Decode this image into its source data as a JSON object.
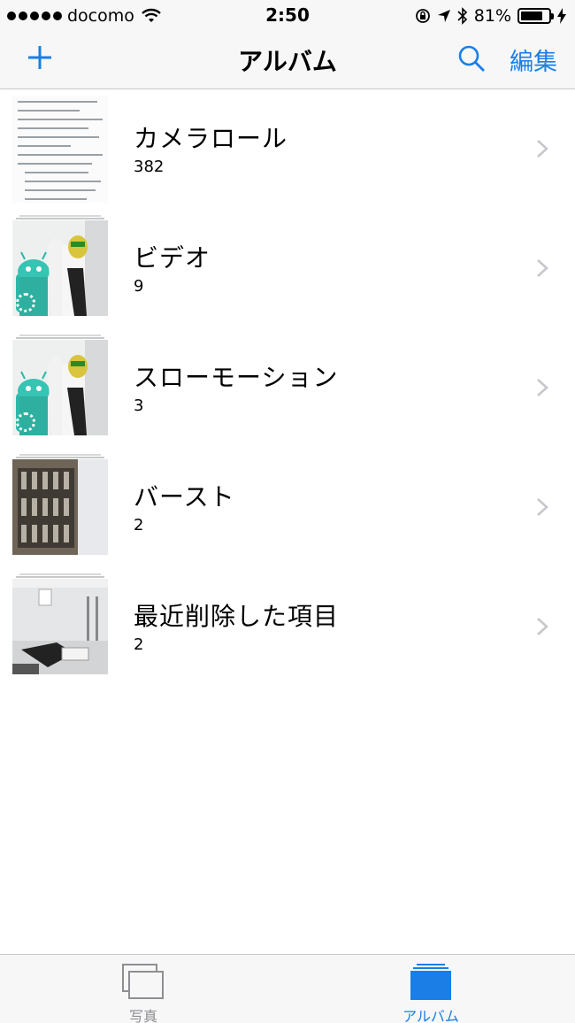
{
  "status_bar": {
    "carrier": "docomo",
    "time": "2:50",
    "battery_percent": "81%",
    "signal_bars": 5,
    "battery_level": 0.81
  },
  "nav": {
    "title": "アルバム",
    "edit_label": "編集",
    "add_icon": "plus-icon",
    "search_icon": "search-icon",
    "accent_color": "#1a7ee6"
  },
  "albums": [
    {
      "name": "カメラロール",
      "count": "382",
      "thumb": "document-screenshot"
    },
    {
      "name": "ビデオ",
      "count": "9",
      "thumb": "robot-mascot-photo"
    },
    {
      "name": "スローモーション",
      "count": "3",
      "thumb": "robot-mascot-photo"
    },
    {
      "name": "バースト",
      "count": "2",
      "thumb": "building-photo"
    },
    {
      "name": "最近削除した項目",
      "count": "2",
      "thumb": "office-photo"
    }
  ],
  "tabs": [
    {
      "label": "写真",
      "icon": "photos-tab-icon",
      "selected": false
    },
    {
      "label": "アルバム",
      "icon": "albums-tab-icon",
      "selected": true
    }
  ]
}
